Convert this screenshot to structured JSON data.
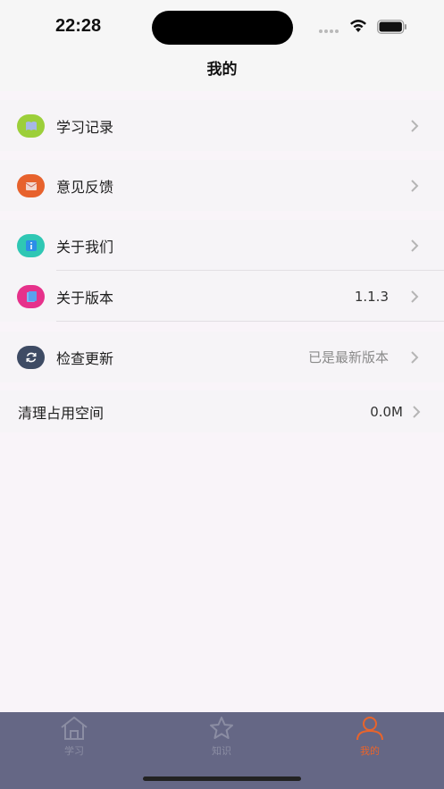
{
  "status_bar": {
    "time": "22:28"
  },
  "nav": {
    "title": "我的"
  },
  "groups": {
    "study": {
      "label": "学习记录",
      "icon": "book-icon",
      "color": "#9ccf3a"
    },
    "feedback": {
      "label": "意见反馈",
      "icon": "mail-icon",
      "color": "#e7622d"
    },
    "about_us": {
      "label": "关于我们",
      "icon": "info-icon",
      "color": "#2fc7b4"
    },
    "version": {
      "label": "关于版本",
      "value": "1.1.3",
      "icon": "pages-icon",
      "color": "#e6318b"
    },
    "update": {
      "label": "检查更新",
      "value": "已是最新版本",
      "icon": "refresh-icon",
      "color": "#3e4b64"
    },
    "cache": {
      "label": "清理占用空间",
      "value": "0.0M"
    }
  },
  "tabs": {
    "study": {
      "label": "学习",
      "icon": "home-icon"
    },
    "knowledge": {
      "label": "知识",
      "icon": "star-icon"
    },
    "mine": {
      "label": "我的",
      "icon": "person-icon",
      "active_color": "#e8642c"
    }
  }
}
